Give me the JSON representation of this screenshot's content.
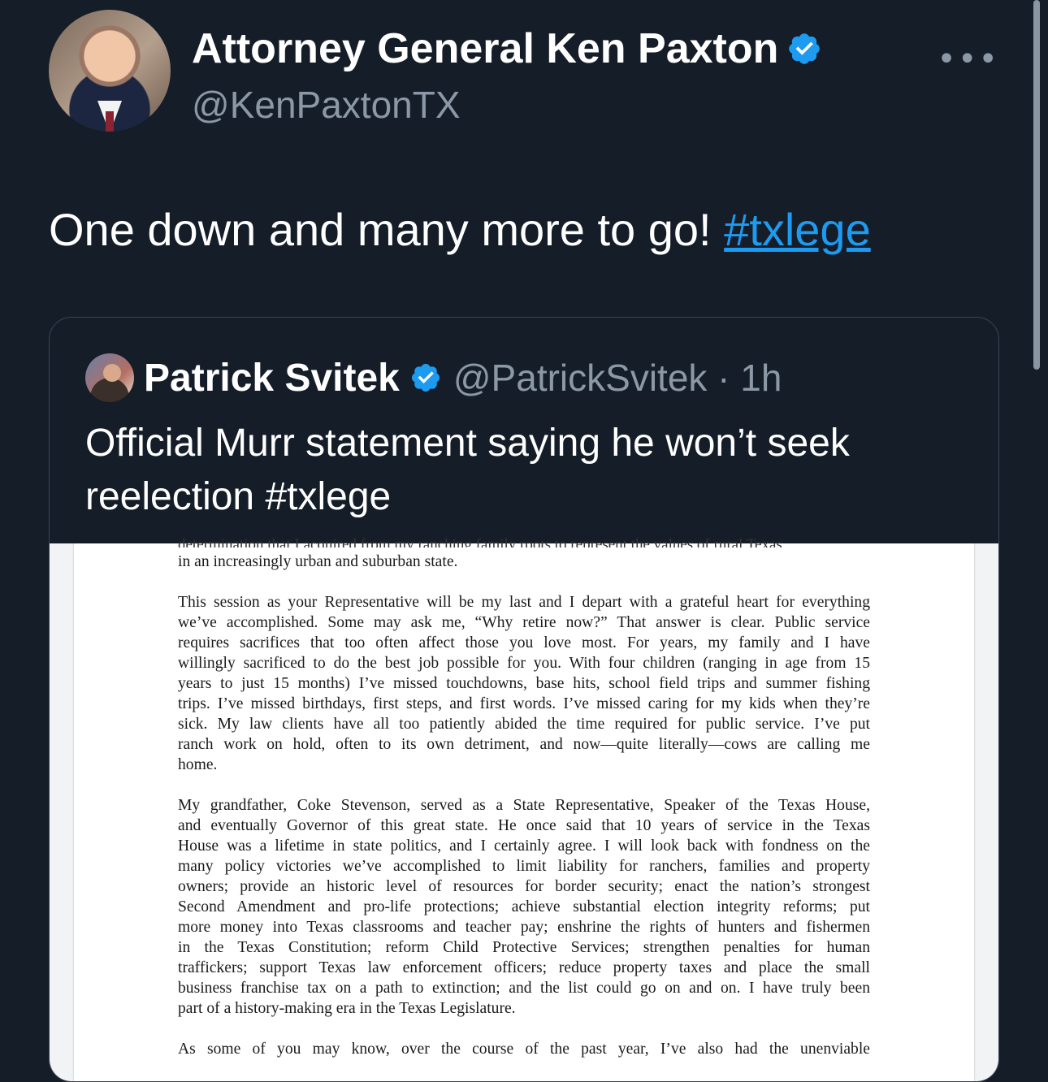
{
  "tweet": {
    "display_name": "Attorney General Ken Paxton",
    "handle": "@KenPaxtonTX",
    "more_icon": "•••",
    "text": "One down and many more to go! ",
    "hashtag": "#txlege"
  },
  "quote": {
    "display_name": "Patrick Svitek",
    "handle_time": "@PatrickSvitek · 1h",
    "text": "Official Murr statement saying he won’t seek reelection #txlege"
  },
  "document": {
    "cut_line": "determination that I acquired from my ranching family roots to represent the values of rural Texas",
    "para0": [
      "in an increasingly urban and suburban state."
    ],
    "para1": [
      "This session as your Representative will be my last and I depart with a grateful heart for everything",
      "we’ve accomplished. Some may ask me, “Why retire now?” That answer is clear. Public service",
      "requires sacrifices that too often affect those you love most. For years, my family and I have",
      "willingly sacrificed to do the best job possible for you. With four children (ranging in age from 15",
      "years to just 15 months) I’ve missed touchdowns, base hits, school field trips and summer fishing",
      "trips. I’ve missed birthdays, first steps, and first words. I’ve missed caring for my kids when they’re",
      "sick. My law clients have all too patiently abided the time required for public service. I’ve put",
      "ranch work on hold, often to its own detriment, and now—quite literally—cows are calling me",
      "home."
    ],
    "para2": [
      "My grandfather, Coke Stevenson, served as a State Representative, Speaker of the Texas House,",
      "and eventually Governor of this great state. He once said that 10 years of service in the Texas",
      "House was a lifetime in state politics, and I certainly agree. I will look back with fondness on the",
      "many policy victories we’ve accomplished to limit liability for ranchers, families and property",
      "owners; provide an historic level of resources for border security; enact the nation’s strongest",
      "Second Amendment and pro-life protections; achieve substantial election integrity reforms; put",
      "more money into Texas classrooms and teacher pay; enshrine the rights of hunters and fishermen",
      "in the Texas Constitution; reform Child Protective Services; strengthen penalties for human",
      "traffickers; support Texas law enforcement officers; reduce property taxes and place the small",
      "business franchise tax on a path to extinction; and the list could go on and on. I have truly been",
      "part of a history-making era in the Texas Legislature."
    ],
    "para3": [
      "As some of you may know, over the course of the past year, I’ve also had the unenviable"
    ]
  },
  "colors": {
    "background": "#151d28",
    "link": "#1d9bf0",
    "verified": "#1d9bf0",
    "secondary_text": "#8b98a5"
  }
}
